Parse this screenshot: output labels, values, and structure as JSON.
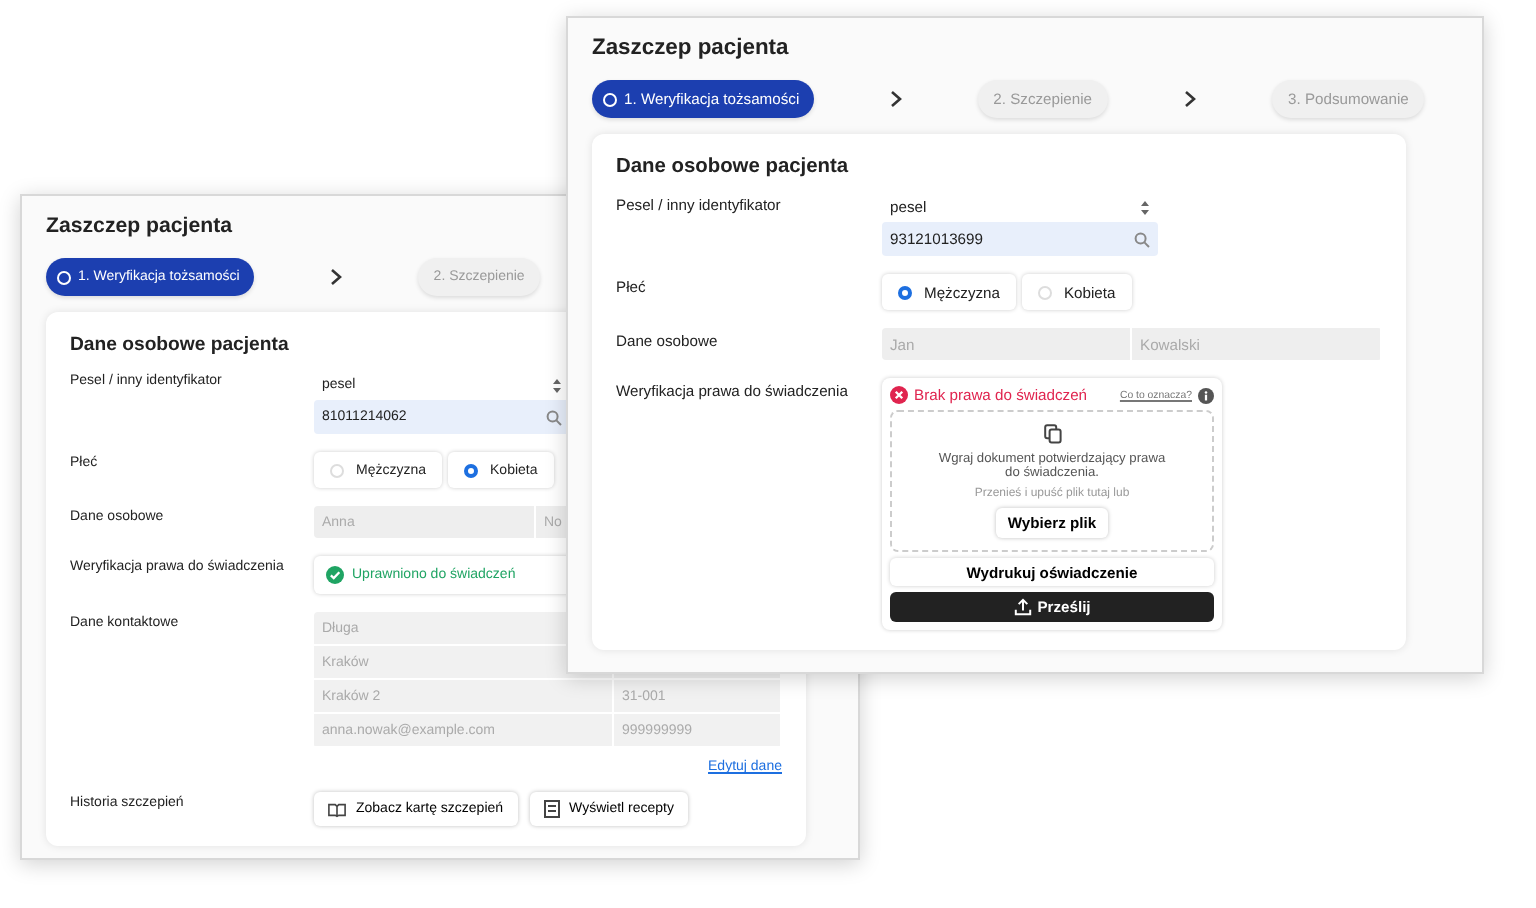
{
  "windows": [
    {
      "title": "Zaszczep pacjenta",
      "steps": [
        {
          "label": "1. Weryfikacja tożsamości",
          "selected": true
        },
        {
          "label": "2. Szczepienie",
          "selected": false
        }
      ],
      "section_title": "Dane osobowe pacjenta",
      "identifier": {
        "label": "Pesel / inny identyfikator",
        "type_value": "pesel",
        "value": "81011214062"
      },
      "sex": {
        "label": "Płeć",
        "options": [
          {
            "label": "Mężczyzna",
            "selected": false
          },
          {
            "label": "Kobieta",
            "selected": true
          }
        ]
      },
      "personal": {
        "label": "Dane osobowe",
        "first_name": "Anna",
        "last_name": "No"
      },
      "eligibility": {
        "label": "Weryfikacja prawa do świadczenia",
        "kind": "eligible",
        "status": "Uprawniono do świadczeń"
      },
      "contact": {
        "label": "Dane kontaktowe",
        "rows": [
          [
            "Długa"
          ],
          [
            "Kraków"
          ],
          [
            "Kraków 2",
            "31-001"
          ],
          [
            "anna.nowak@example.com",
            "999999999"
          ]
        ],
        "edit_link": "Edytuj dane"
      },
      "history": {
        "label": "Historia szczepień",
        "buttons": [
          "Zobacz kartę szczepień",
          "Wyświetl recepty"
        ]
      }
    },
    {
      "title": "Zaszczep pacjenta",
      "steps": [
        {
          "label": "1. Weryfikacja tożsamości",
          "selected": true
        },
        {
          "label": "2. Szczepienie",
          "selected": false
        },
        {
          "label": "3. Podsumowanie",
          "selected": false
        }
      ],
      "section_title": "Dane osobowe pacjenta",
      "identifier": {
        "label": "Pesel / inny identyfikator",
        "type_value": "pesel",
        "value": "93121013699"
      },
      "sex": {
        "label": "Płeć",
        "options": [
          {
            "label": "Mężczyzna",
            "selected": true
          },
          {
            "label": "Kobieta",
            "selected": false
          }
        ]
      },
      "personal": {
        "label": "Dane osobowe",
        "first_name": "Jan",
        "last_name": "Kowalski"
      },
      "eligibility": {
        "label": "Weryfikacja prawa do świadczenia",
        "kind": "denied",
        "status": "Brak prawa do świadczeń",
        "help_link": "Co to oznacza?",
        "upload": {
          "text": "Wgraj dokument potwierdzający prawa do świadczenia.",
          "hint": "Przenieś i upuść plik tutaj lub",
          "button": "Wybierz plik"
        },
        "print_button": "Wydrukuj oświadczenie",
        "submit_button": "Prześlij"
      }
    }
  ]
}
